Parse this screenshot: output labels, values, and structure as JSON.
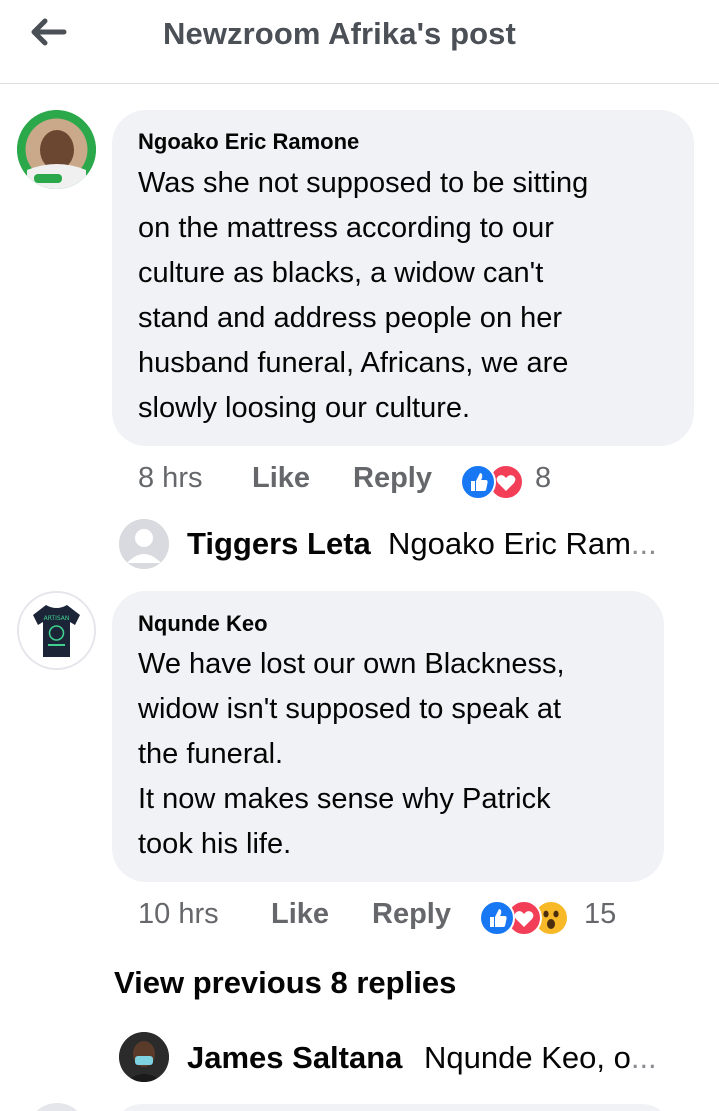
{
  "header": {
    "title": "Newzroom Afrika's post",
    "back_icon": "arrow-left-icon"
  },
  "comments": [
    {
      "author": "Ngoako Eric Ramone",
      "lines": [
        "Was she not supposed to be sitting",
        "on the mattress according to our",
        "culture as blacks, a widow can't",
        "stand and address people on her",
        "husband funeral, Africans, we are",
        "slowly loosing our culture."
      ],
      "time": "8 hrs",
      "like_label": "Like",
      "reply_label": "Reply",
      "reaction_count": "8",
      "reactions": [
        "like",
        "love"
      ]
    },
    {
      "author": "Nqunde Keo",
      "lines": [
        "We have lost our own Blackness,",
        "widow isn't supposed to speak at",
        "the funeral.",
        "It now makes sense why Patrick",
        "took his life."
      ],
      "time": "10 hrs",
      "like_label": "Like",
      "reply_label": "Reply",
      "reaction_count": "15",
      "reactions": [
        "like",
        "love",
        "wow"
      ]
    }
  ],
  "replies": [
    {
      "name": "Tiggers Leta",
      "preview": "Ngoako Eric Ram",
      "ellipsis": "..."
    },
    {
      "name": "James Saltana",
      "preview": "Nqunde Keo, o",
      "ellipsis": "..."
    }
  ],
  "view_previous": "View previous 8 replies",
  "colors": {
    "bubble": "#f0f2f5",
    "like_blue": "#1877f2",
    "love_red": "#f33e58",
    "wow_yellow": "#f7b928",
    "secondary_text": "#65676b"
  }
}
